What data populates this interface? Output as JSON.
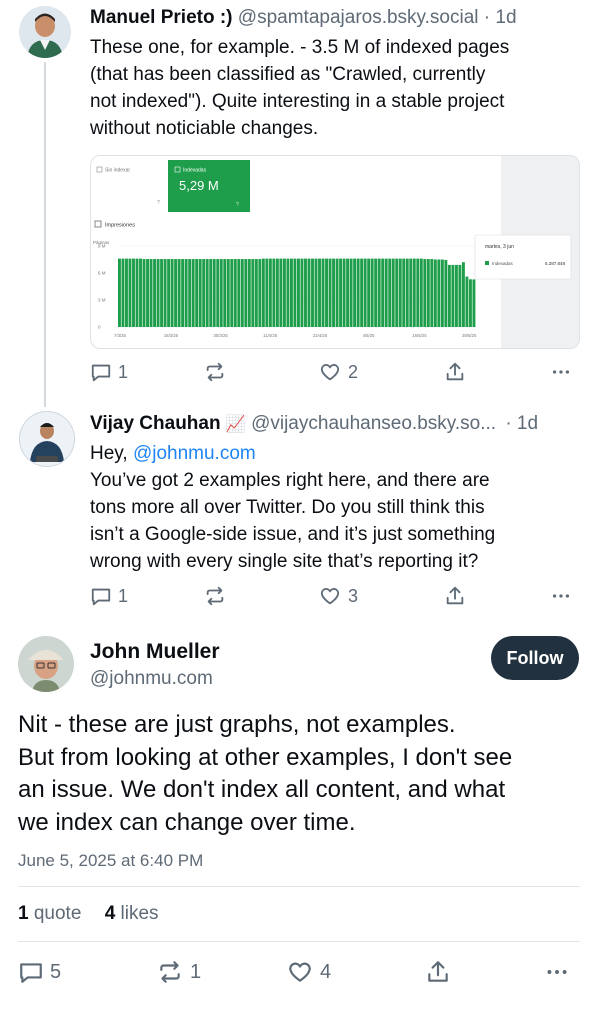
{
  "posts": [
    {
      "author": "Manuel Prieto :)",
      "handle": "@spamtapajaros.bsky.social",
      "age": "· 1d",
      "text_lines": [
        "These one, for example. - 3.5 M of indexed pages",
        "(that has been classified as \"Crawled, currently",
        "not indexed\"). Quite interesting in a stable project",
        "without noticiable changes."
      ],
      "actions": {
        "replies": "1",
        "reposts": "",
        "likes": "2"
      }
    },
    {
      "author": "Vijay Chauhan",
      "author_emoji": "📈",
      "handle": "@vijaychauhanseo.bsky.so...",
      "age": "· 1d",
      "greeting": "Hey,",
      "mention": "@johnmu.com",
      "text_lines": [
        "You’ve got 2 examples right here, and there are",
        "tons more all over Twitter. Do you still think this",
        "isn’t a Google-side issue, and it’s just something",
        "wrong with every single site that’s reporting it?"
      ],
      "actions": {
        "replies": "1",
        "reposts": "",
        "likes": "3"
      }
    }
  ],
  "embed_chart": {
    "tile_not_indexed": "Sin indexar",
    "tile_indexed": "Indexadas",
    "tile_indexed_value": "5,29 M",
    "impressions_label": "Impresiones",
    "y_axis_title": "Páginas",
    "y_ticks": [
      "9 M",
      "6 M",
      "3 M",
      "0"
    ],
    "x_ticks": [
      "7/3/25",
      "18/3/25",
      "30/3/25",
      "11/4/25",
      "22/4/25",
      "4/5/25",
      "16/5/25",
      "28/5/25"
    ],
    "tooltip_date": "martes, 3 jun",
    "tooltip_series": "Indexadas",
    "tooltip_value": "5.287.848",
    "bar_color": "#1e9e4a",
    "bar_values_m": [
      7.6,
      7.6,
      7.6,
      7.6,
      7.6,
      7.6,
      7.6,
      7.55,
      7.55,
      7.55,
      7.55,
      7.55,
      7.55,
      7.55,
      7.55,
      7.55,
      7.55,
      7.55,
      7.55,
      7.55,
      7.55,
      7.55,
      7.55,
      7.55,
      7.55,
      7.55,
      7.55,
      7.55,
      7.55,
      7.55,
      7.55,
      7.55,
      7.55,
      7.55,
      7.55,
      7.55,
      7.55,
      7.55,
      7.55,
      7.55,
      7.55,
      7.6,
      7.6,
      7.6,
      7.6,
      7.6,
      7.6,
      7.6,
      7.6,
      7.6,
      7.6,
      7.6,
      7.6,
      7.6,
      7.6,
      7.6,
      7.6,
      7.6,
      7.6,
      7.6,
      7.6,
      7.6,
      7.6,
      7.6,
      7.6,
      7.6,
      7.6,
      7.6,
      7.6,
      7.6,
      7.6,
      7.6,
      7.6,
      7.6,
      7.6,
      7.6,
      7.6,
      7.6,
      7.6,
      7.6,
      7.6,
      7.6,
      7.6,
      7.6,
      7.6,
      7.6,
      7.6,
      7.55,
      7.55,
      7.55,
      7.5,
      7.5,
      7.5,
      7.45,
      6.9,
      6.9,
      6.9,
      6.9,
      7.2,
      5.6,
      5.3,
      5.29
    ]
  },
  "main_post": {
    "author": "John Mueller",
    "handle": "@johnmu.com",
    "follow_label": "Follow",
    "text_lines": [
      "Nit - these are just graphs, not examples.",
      "But from looking at other examples, I don't see",
      "an issue. We don't index all content, and what",
      "we index can change over time."
    ],
    "timestamp": "June 5, 2025 at 6:40 PM",
    "quotes_count": "1",
    "quotes_label": "quote",
    "likes_count": "4",
    "likes_label": "likes",
    "actions": {
      "replies": "5",
      "reposts": "1",
      "likes": "4"
    }
  },
  "icons": [
    "reply-icon",
    "repost-icon",
    "like-icon",
    "share-icon",
    "more-icon"
  ]
}
